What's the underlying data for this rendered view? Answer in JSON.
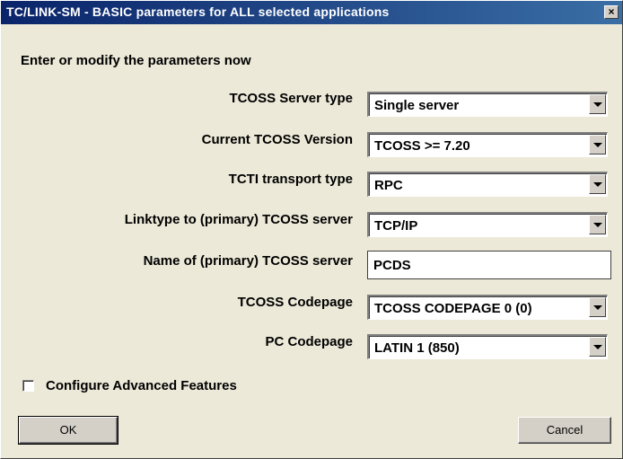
{
  "window": {
    "title": "TC/LINK-SM - BASIC parameters for ALL selected applications",
    "close_glyph": "×"
  },
  "intro": "Enter or modify the parameters now",
  "fields": {
    "server_type": {
      "label": "TCOSS Server type",
      "value": "Single server"
    },
    "tcoss_version": {
      "label": "Current TCOSS Version",
      "value": "TCOSS >= 7.20"
    },
    "tcti_transport": {
      "label": "TCTI transport type",
      "value": "RPC"
    },
    "linktype": {
      "label": "Linktype to (primary)  TCOSS server",
      "value": "TCP/IP"
    },
    "server_name": {
      "label": "Name of (primary)  TCOSS server",
      "value": "PCDS"
    },
    "tcoss_codepage": {
      "label": "TCOSS Codepage",
      "value": "TCOSS CODEPAGE 0 (0)"
    },
    "pc_codepage": {
      "label": "PC Codepage",
      "value": "LATIN 1 (850)"
    }
  },
  "advanced": {
    "label": "Configure Advanced Features",
    "checked": false
  },
  "buttons": {
    "ok": "OK",
    "cancel": "Cancel"
  },
  "icons": {
    "close": "close-icon",
    "dropdown": "chevron-down-icon"
  },
  "colors": {
    "titlebar": "#0a246a",
    "dialog_bg": "#ece9d8",
    "field_bg": "#ffffff"
  }
}
